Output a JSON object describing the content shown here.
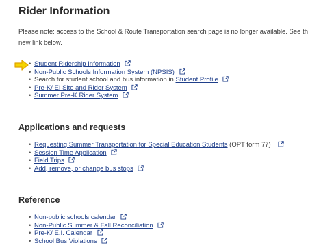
{
  "header": {
    "title": "Rider Information"
  },
  "notice": {
    "line1": "Please note: access to the School & Route Transportation search page is no longer available. See th",
    "line2": "new link below."
  },
  "rider_links": [
    {
      "label": "Student Ridership Information"
    },
    {
      "label": "Non-Public Schools Information System (NPSIS)"
    },
    {
      "prefix": "Search for student school and bus information in ",
      "label": "Student Profile"
    },
    {
      "label": "Pre-K/ EI Site and Rider System"
    },
    {
      "label": "Summer Pre-K Rider System"
    }
  ],
  "applications": {
    "heading": "Applications and requests",
    "items": [
      {
        "label": "Requesting Summer Transportation for Special Education Students",
        "suffix": " (OPT form 77)"
      },
      {
        "label": "Session Time Application"
      },
      {
        "label": "Field Trips"
      },
      {
        "label": "Add, remove, or change bus stops"
      }
    ]
  },
  "reference": {
    "heading": "Reference",
    "items": [
      {
        "label": "Non-public schools calendar"
      },
      {
        "label": "Non-Public Summer & Fall Reconciliation"
      },
      {
        "label": "Pre-K/ E.I. Calendar"
      },
      {
        "label": "School Bus Violations"
      }
    ]
  },
  "icons": {
    "external_link": "external-link-icon",
    "pointer": "right-arrow-icon"
  },
  "colors": {
    "link": "#1f3f8a",
    "heading": "#2b2b2b",
    "arrow_fill": "#f5d400",
    "arrow_stroke": "#e0a300"
  }
}
